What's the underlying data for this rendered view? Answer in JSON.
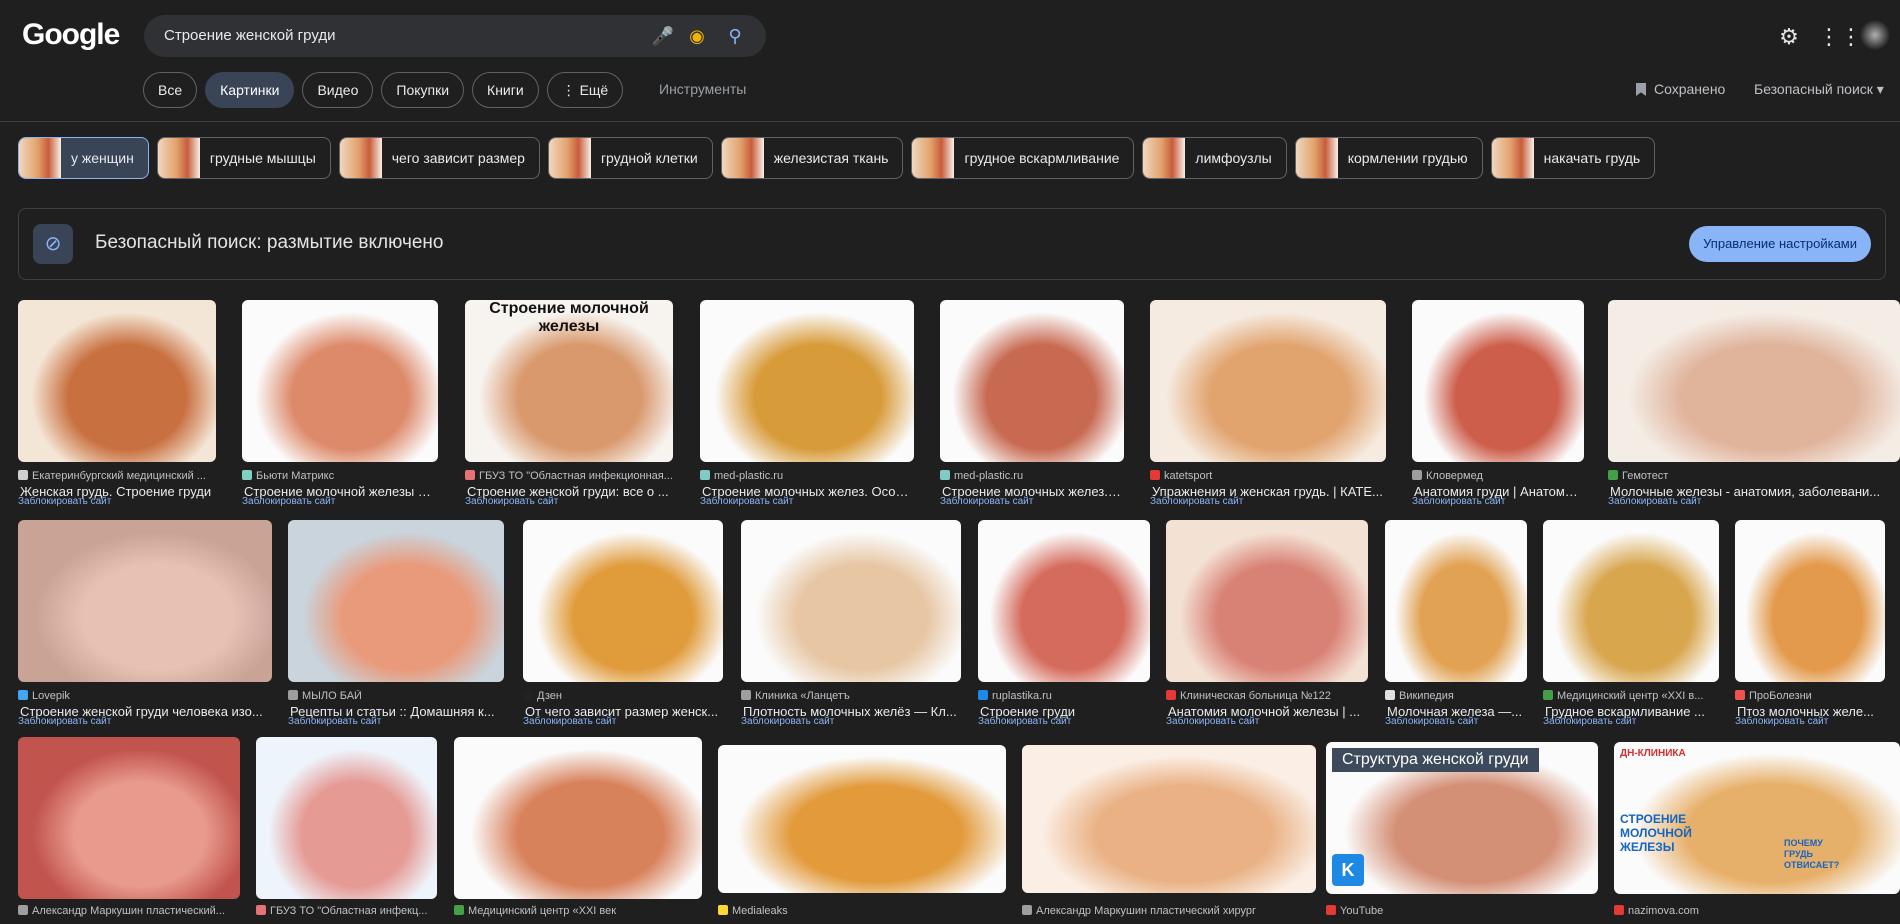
{
  "logo": "Google",
  "search": {
    "query": "Строение женской груди"
  },
  "tabs": [
    {
      "label": "Все"
    },
    {
      "label": "Картинки",
      "active": true
    },
    {
      "label": "Видео"
    },
    {
      "label": "Покупки"
    },
    {
      "label": "Книги"
    },
    {
      "label": "⋮ Ещё"
    }
  ],
  "tools_label": "Инструменты",
  "saved_label": "Сохранено",
  "safe_search_label": "Безопасный поиск",
  "chips": [
    {
      "label": "у женщин",
      "selected": true
    },
    {
      "label": "грудные мышцы"
    },
    {
      "label": "чего зависит размер"
    },
    {
      "label": "грудной клетки"
    },
    {
      "label": "железистая ткань"
    },
    {
      "label": "грудное вскармливание"
    },
    {
      "label": "лимфоузлы"
    },
    {
      "label": "кормлении грудью"
    },
    {
      "label": "накачать грудь"
    }
  ],
  "banner": {
    "text": "Безопасный поиск: размытие включено",
    "button": "Управление настройками"
  },
  "block_label": "Заблокировать сайт",
  "results": [
    {
      "source": "Екатеринбургский медицинский ...",
      "title": "Женская грудь. Строение груди",
      "fav": "#cfcfcf"
    },
    {
      "source": "Бьюти Матрикс",
      "title": "Строение молочной железы ж...",
      "fav": "#7fd0c0"
    },
    {
      "source": "ГБУЗ ТО \"Областная инфекционная...",
      "title": "Строение женской груди: все о ...",
      "fav": "#e57373",
      "overlay": "Строение молочной железы"
    },
    {
      "source": "med-plastic.ru",
      "title": "Строение молочных желез. Особ...",
      "fav": "#80cbc4"
    },
    {
      "source": "med-plastic.ru",
      "title": "Строение молочных желез. ...",
      "fav": "#80cbc4"
    },
    {
      "source": "katetsport",
      "title": "Упражнения и женская грудь. | КАТЕ...",
      "fav": "#e53935"
    },
    {
      "source": "Кловермед",
      "title": "Анатомия груди | Анатоми...",
      "fav": "#9e9e9e"
    },
    {
      "source": "Гемотест",
      "title": "Молочные железы - анатомия, заболевани...",
      "fav": "#43a047"
    },
    {
      "source": "Lovepik",
      "title": "Строение женской груди человека изо...",
      "fav": "#42a5f5"
    },
    {
      "source": "МЫЛО БАЙ",
      "title": "Рецепты и статьи :: Домашняя к...",
      "fav": "#9e9e9e"
    },
    {
      "source": "Дзен",
      "title": "От чего зависит размер женск...",
      "fav": "#212121"
    },
    {
      "source": "Клиника «Ланцетъ",
      "title": "Плотность молочных желёз — Кл...",
      "fav": "#9e9e9e"
    },
    {
      "source": "ruplastika.ru",
      "title": "Строение груди",
      "fav": "#1e88e5"
    },
    {
      "source": "Клиническая больница №122",
      "title": "Анатомия молочной железы | ...",
      "fav": "#e53935"
    },
    {
      "source": "Википедия",
      "title": "Молочная железа —...",
      "fav": "#e0e0e0"
    },
    {
      "source": "Медицинский центр «XXI в...",
      "title": "Грудное вскармливание ...",
      "fav": "#43a047"
    },
    {
      "source": "ПроБолезни",
      "title": "Птоз молочных желе...",
      "fav": "#ef5350"
    },
    {
      "source": "Александр Маркушин пластический...",
      "title": "",
      "fav": "#9e9e9e"
    },
    {
      "source": "ГБУЗ ТО \"Областная инфекц...",
      "title": "",
      "fav": "#e57373"
    },
    {
      "source": "Медицинский центр «XXI век",
      "title": "",
      "fav": "#43a047"
    },
    {
      "source": "Medialeaks",
      "title": "",
      "fav": "#fdd835"
    },
    {
      "source": "Александр Маркушин пластический хирург",
      "title": "",
      "fav": "#9e9e9e"
    },
    {
      "source": "YouTube",
      "title": "",
      "fav": "#e53935",
      "overlay": "Структура женской груди",
      "badge": "K"
    },
    {
      "source": "nazimova.com",
      "title": "",
      "fav": "#e53935",
      "overlay": "СТРОЕНИЕ МОЛОЧНОЙ ЖЕЛЕЗЫ",
      "overlay2": "ПОЧЕМУ ГРУДЬ ОТВИСАЕТ?",
      "logo_text": "ДН-КЛИНИКА"
    }
  ]
}
